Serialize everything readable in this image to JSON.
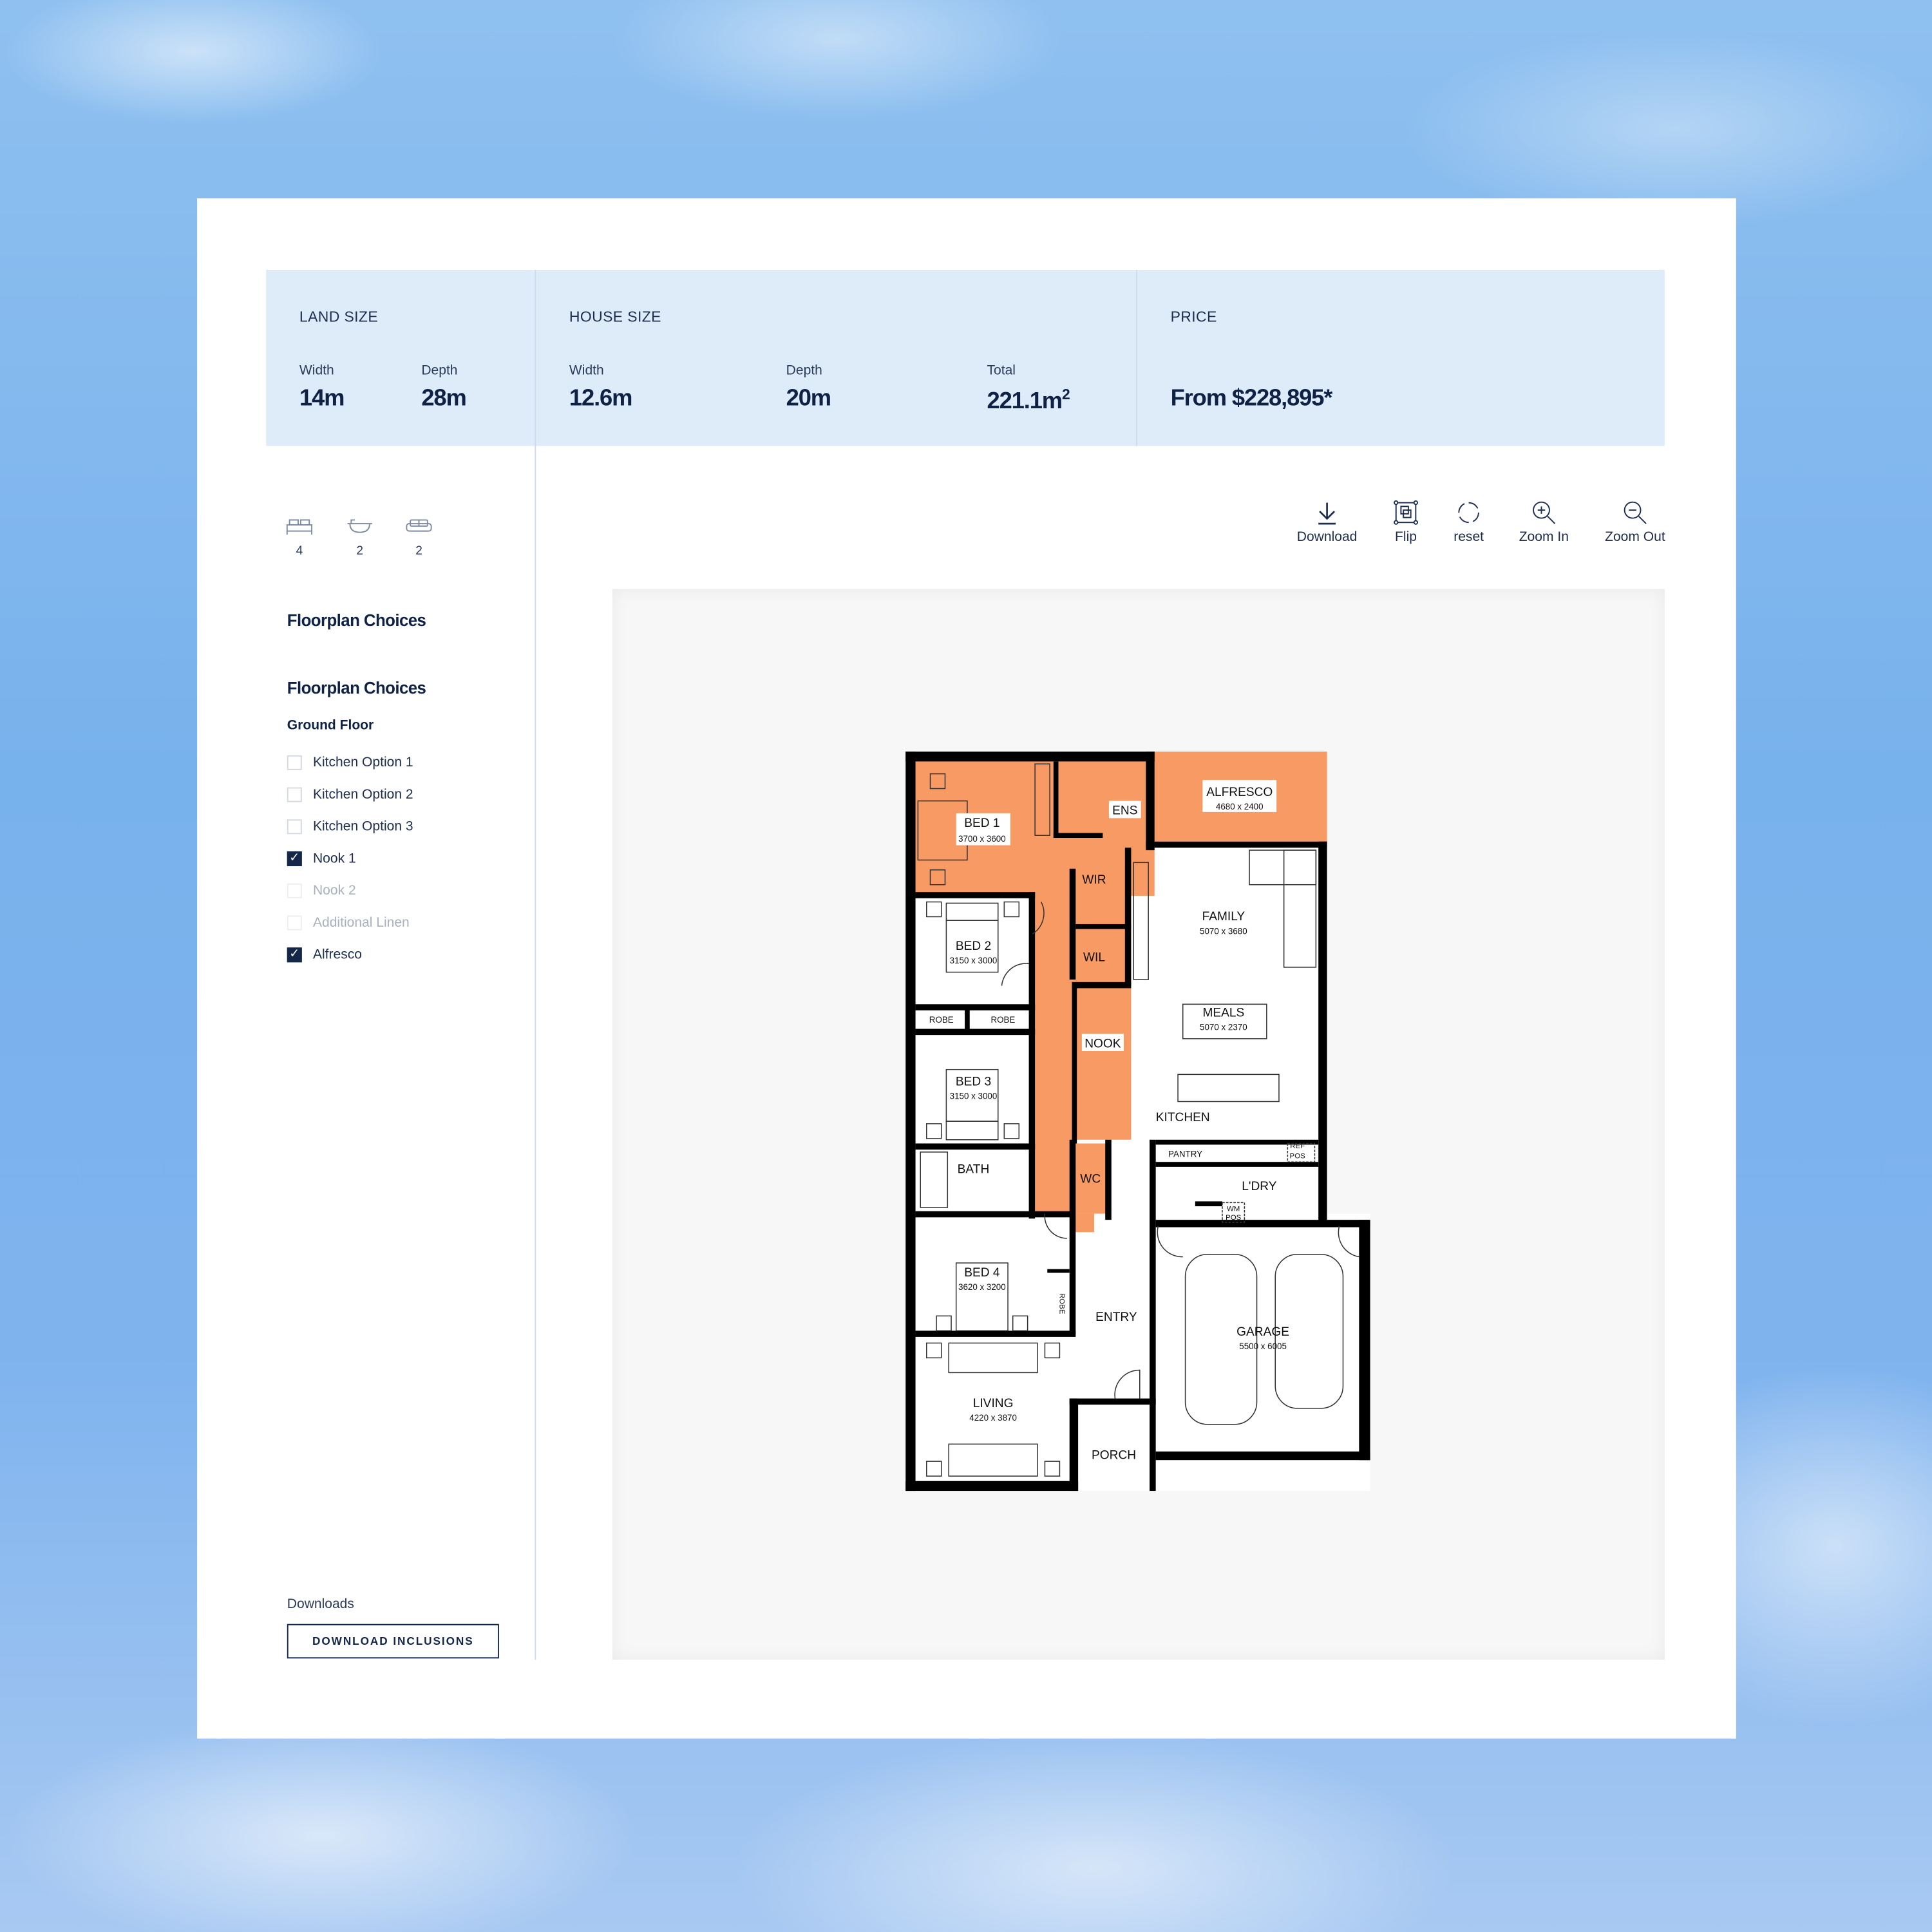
{
  "summary": {
    "land": {
      "title": "LAND SIZE",
      "width_label": "Width",
      "width": "14m",
      "depth_label": "Depth",
      "depth": "28m"
    },
    "house": {
      "title": "HOUSE SIZE",
      "width_label": "Width",
      "width": "12.6m",
      "depth_label": "Depth",
      "depth": "20m",
      "total_label": "Total",
      "total": "221.1m",
      "total_unit_sup": "2"
    },
    "price": {
      "title": "PRICE",
      "value": "From $228,895*"
    }
  },
  "amenities": [
    {
      "icon": "bed-icon",
      "count": "4"
    },
    {
      "icon": "bath-icon",
      "count": "2"
    },
    {
      "icon": "sofa-icon",
      "count": "2"
    }
  ],
  "sidebar": {
    "heading_1": "Floorplan Choices",
    "heading_2": "Floorplan Choices",
    "floor": "Ground Floor",
    "options": [
      {
        "label": "Kitchen Option 1",
        "checked": false,
        "disabled": false
      },
      {
        "label": "Kitchen Option 2",
        "checked": false,
        "disabled": false
      },
      {
        "label": "Kitchen Option 3",
        "checked": false,
        "disabled": false
      },
      {
        "label": "Nook 1",
        "checked": true,
        "disabled": false
      },
      {
        "label": "Nook 2",
        "checked": false,
        "disabled": true
      },
      {
        "label": "Additional Linen",
        "checked": false,
        "disabled": true
      },
      {
        "label": "Alfresco",
        "checked": true,
        "disabled": false
      }
    ],
    "downloads_label": "Downloads",
    "download_button": "DOWNLOAD INCLUSIONS"
  },
  "toolbar": {
    "download": "Download",
    "flip": "Flip",
    "reset": "reset",
    "zoom_in": "Zoom In",
    "zoom_out": "Zoom Out"
  },
  "colors": {
    "navy": "#14264a",
    "band": "#deebf8",
    "highlight": "#f79a63"
  },
  "plan": {
    "rooms": [
      {
        "name": "BED 1",
        "dims": "3700 x 3600"
      },
      {
        "name": "ENS"
      },
      {
        "name": "ALFRESCO",
        "dims": "4680 x 2400"
      },
      {
        "name": "WIR"
      },
      {
        "name": "FAMILY",
        "dims": "5070 x 3680"
      },
      {
        "name": "BED 2",
        "dims": "3150 x 3000"
      },
      {
        "name": "WIL"
      },
      {
        "name": "ROBE"
      },
      {
        "name": "ROBE"
      },
      {
        "name": "MEALS",
        "dims": "5070 x 2370"
      },
      {
        "name": "NOOK"
      },
      {
        "name": "BED 3",
        "dims": "3150 x 3000"
      },
      {
        "name": "KITCHEN"
      },
      {
        "name": "PANTRY"
      },
      {
        "name": "REF",
        "dims": "POS"
      },
      {
        "name": "BATH"
      },
      {
        "name": "WC"
      },
      {
        "name": "L'DRY"
      },
      {
        "name": "WM",
        "dims": "POS"
      },
      {
        "name": "BED 4",
        "dims": "3620 x 3200"
      },
      {
        "name": "ROBE"
      },
      {
        "name": "ENTRY"
      },
      {
        "name": "GARAGE",
        "dims": "5500 x 6005"
      },
      {
        "name": "LIVING",
        "dims": "4220 x 3870"
      },
      {
        "name": "PORCH"
      }
    ]
  }
}
